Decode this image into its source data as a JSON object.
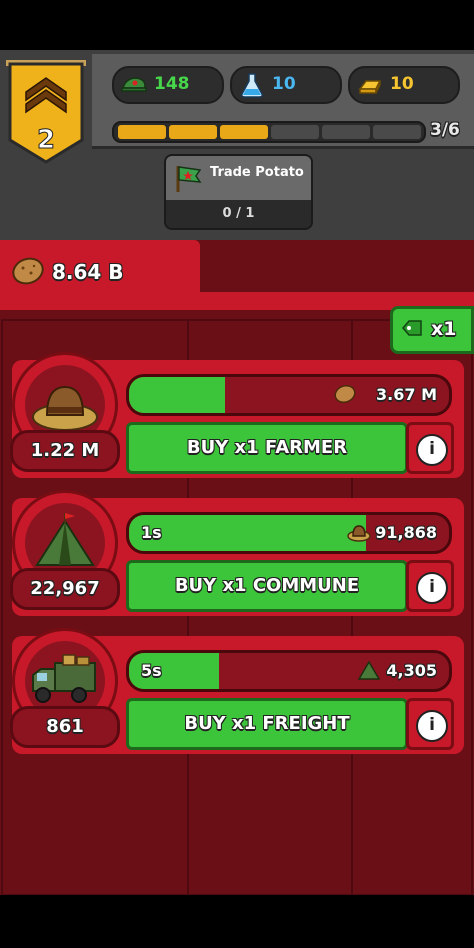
{
  "header": {
    "rank_number": "2",
    "resources": [
      {
        "icon": "cap-icon",
        "value": "148"
      },
      {
        "icon": "flask-icon",
        "value": "10"
      },
      {
        "icon": "gold-bar-icon",
        "value": "10"
      }
    ],
    "xp_progress": "3/6",
    "xp_filled_segments": 3,
    "xp_total_segments": 6
  },
  "quest": {
    "title": "Trade Potato",
    "progress": "0 / 1",
    "icon": "flag-icon"
  },
  "currency": {
    "icon": "potato-icon",
    "value": "8.64 B"
  },
  "multiplier": {
    "label": "x1"
  },
  "rows": [
    {
      "name": "farmer",
      "icon": "straw-hat-icon",
      "count": "1.22 M",
      "time": "",
      "progress": 0.3,
      "yield_icon": "potato-icon",
      "yield": "3.67 M",
      "buy_label": "BUY x1 FARMER"
    },
    {
      "name": "commune",
      "icon": "tent-icon",
      "count": "22,967",
      "time": "1s",
      "progress": 0.74,
      "yield_icon": "straw-hat-icon",
      "yield": "91,868",
      "buy_label": "BUY x1 COMMUNE"
    },
    {
      "name": "freight",
      "icon": "truck-icon",
      "count": "861",
      "time": "5s",
      "progress": 0.28,
      "yield_icon": "tent-icon",
      "yield": "4,305",
      "buy_label": "BUY x1 FREIGHT"
    }
  ],
  "colors": {
    "green": "#3cc53a",
    "red": "#c8192a",
    "dark_red": "#6a0f16",
    "gold": "#e9a818"
  }
}
